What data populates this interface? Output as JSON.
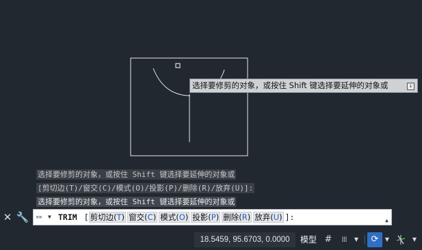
{
  "tooltip": {
    "text": "选择要修剪的对象，或按住 Shift 键选择要延伸的对象或"
  },
  "history": [
    "选择要修剪的对象，或按住 Shift 键选择要延伸的对象或",
    " [剪切边(T)/窗交(C)/模式(O)/投影(P)/删除(R)/放弃(U)]:",
    "选择要修剪的对象，或按住 Shift 键选择要延伸的对象或"
  ],
  "command_line": {
    "command": "TRIM",
    "open_bracket": "[",
    "options": [
      {
        "label": "剪切边(",
        "key": "T",
        "close": ")"
      },
      {
        "label": "窗交(",
        "key": "C",
        "close": ")"
      },
      {
        "label": "模式(",
        "key": "O",
        "close": ")"
      },
      {
        "label": "投影(",
        "key": "P",
        "close": ")"
      },
      {
        "label": "删除(",
        "key": "R",
        "close": ")"
      },
      {
        "label": "放弃(",
        "key": "U",
        "close": ")"
      }
    ],
    "close_bracket": "]:"
  },
  "status": {
    "coordinates": "18.5459, 95.6703, 0.0000",
    "model_label": "模型"
  },
  "icons": {
    "close": "close-icon",
    "customize": "wrench-icon",
    "grid": "grid-icon",
    "snap": "snap-icon",
    "polar": "polar-tracking-icon",
    "ortho": "isodraft-icon"
  },
  "colors": {
    "background": "#212830",
    "drawing_lines": "#ffffff",
    "polar_active": "#2f6fc7"
  }
}
